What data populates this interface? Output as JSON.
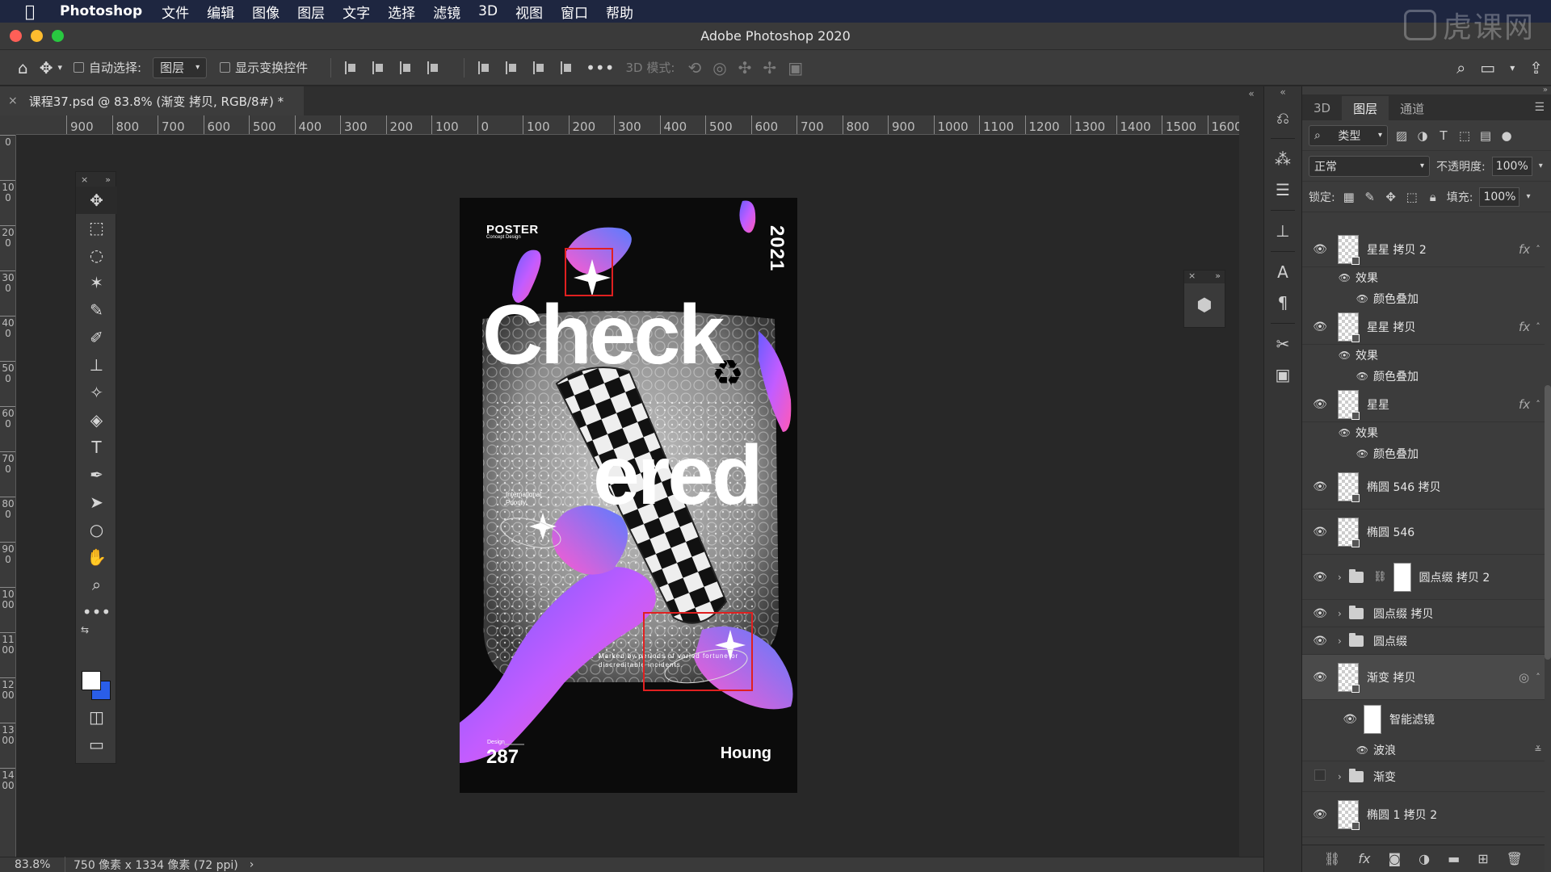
{
  "menubar": {
    "app_name": "Photoshop",
    "items": [
      "文件",
      "编辑",
      "图像",
      "图层",
      "文字",
      "选择",
      "滤镜",
      "3D",
      "视图",
      "窗口",
      "帮助"
    ]
  },
  "window": {
    "title": "Adobe Photoshop 2020",
    "watermark": "虎课网"
  },
  "options_bar": {
    "auto_select_label": "自动选择:",
    "auto_select_value": "图层",
    "show_transform_label": "显示变换控件",
    "mode_3d_label": "3D 模式:"
  },
  "document": {
    "tab_title": "课程37.psd @ 83.8% (渐变 拷贝, RGB/8#) *"
  },
  "ruler": {
    "h_ticks": [
      "900",
      "800",
      "700",
      "600",
      "500",
      "400",
      "300",
      "200",
      "100",
      "0",
      "100",
      "200",
      "300",
      "400",
      "500",
      "600",
      "700",
      "800",
      "900",
      "1000",
      "1100",
      "1200",
      "1300",
      "1400",
      "1500",
      "1600",
      "17"
    ],
    "v_ticks": [
      "0",
      "100",
      "200",
      "300",
      "400",
      "500",
      "600",
      "700",
      "800",
      "900",
      "1000",
      "1100",
      "1200",
      "1300",
      "1400"
    ]
  },
  "poster": {
    "brand": "POSTER",
    "brand_sub": "Concept Design",
    "year": "2021",
    "word_top": "Check",
    "word_bottom": "ered",
    "intl": "International Priority",
    "note": "Marked by periods of varied fortune or discreditable incidents.",
    "design_label": "Design",
    "number": "287",
    "author": "Houng"
  },
  "status": {
    "zoom": "83.8%",
    "doc_info": "750 像素 x 1334 像素 (72 ppi)"
  },
  "layers_panel": {
    "tabs": [
      "3D",
      "图层",
      "通道"
    ],
    "filter_kind": "类型",
    "blend_mode": "正常",
    "opacity_label": "不透明度:",
    "opacity_value": "100%",
    "lock_label": "锁定:",
    "fill_label": "填充:",
    "fill_value": "100%",
    "layers": [
      {
        "name": "星星 拷贝 2",
        "effects": "效果",
        "effect_item": "颜色叠加"
      },
      {
        "name": "星星 拷贝",
        "effects": "效果",
        "effect_item": "颜色叠加"
      },
      {
        "name": "星星",
        "effects": "效果",
        "effect_item": "颜色叠加"
      },
      {
        "name": "椭圆 546 拷贝"
      },
      {
        "name": "椭圆 546"
      },
      {
        "name": "圆点缀 拷贝 2"
      },
      {
        "name": "圆点缀 拷贝"
      },
      {
        "name": "圆点缀"
      },
      {
        "name": "渐变 拷贝",
        "smart_filters": "智能滤镜",
        "filter_item": "波浪"
      },
      {
        "name": "渐变"
      },
      {
        "name": "椭圆 1 拷贝 2"
      }
    ]
  }
}
